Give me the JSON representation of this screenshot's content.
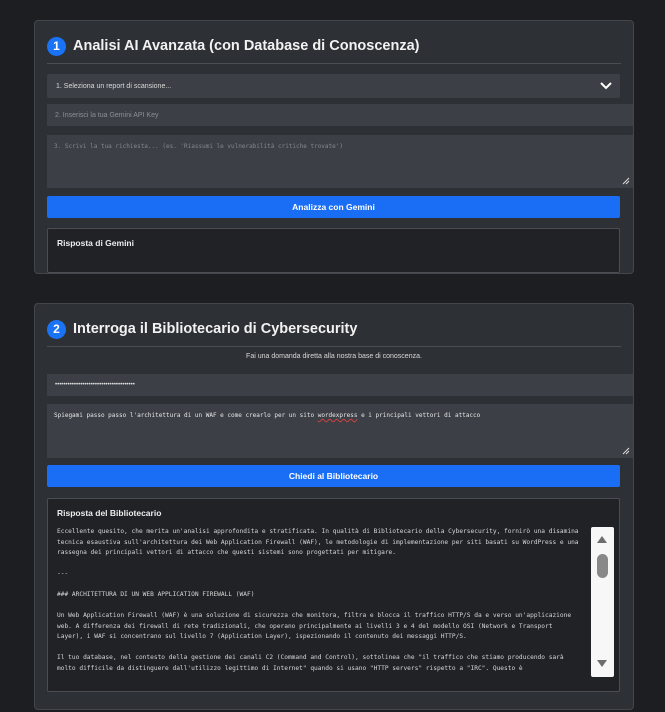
{
  "section1": {
    "number": "1",
    "title": "Analisi AI Avanzata (con Database di Conoscenza)",
    "report_select": "1. Seleziona un report di scansione...",
    "api_key_placeholder": "2. Inserisci la tua Gemini API Key",
    "prompt_placeholder": "3. Scrivi la tua richiesta... (es. 'Riassumi le vulnerabilità critiche trovate')",
    "analyze_button": "Analizza con Gemini",
    "response_title": "Risposta di Gemini"
  },
  "section2": {
    "number": "2",
    "title": "Interroga il Bibliotecario di Cybersecurity",
    "subtitle": "Fai una domanda diretta alla nostra base di conoscenza.",
    "api_key_value": "••••••••••••••••••••••••••••••••••••••",
    "question_part1": "Spiegami passo passo l'architettura di un WAF e come crearlo per un sito ",
    "question_misspelled": "wordexpress",
    "question_part2": " e i principali vettori di attacco",
    "ask_button": "Chiedi al Bibliotecario",
    "response_title": "Risposta del Bibliotecario",
    "response_paragraphs": [
      "Eccellente quesito, che merita un'analisi approfondita e stratificata. In qualità di Bibliotecario della Cybersecurity, fornirò una disamina tecnica esaustiva sull'architettura dei Web Application Firewall (WAF), le metodologie di implementazione per siti basati su WordPress e una rassegna dei principali vettori di attacco che questi sistemi sono progettati per mitigare.",
      "---",
      "### ARCHITETTURA DI UN WEB APPLICATION FIREWALL (WAF)",
      "Un Web Application Firewall (WAF) è una soluzione di sicurezza che monitora, filtra e blocca il traffico HTTP/S da e verso un'applicazione web. A differenza dei firewall di rete tradizionali, che operano principalmente ai livelli 3 e 4 del modello OSI (Network e Transport Layer), i WAF si concentrano sul livello 7 (Application Layer), ispezionando il contenuto dei messaggi HTTP/S.",
      "Il tuo database, nel contesto della gestione dei canali C2 (Command and Control), sottolinea che \"il traffico che stiamo producendo sarà molto difficile da distinguere dall'utilizzo legittimo di Internet\" quando si usano \"HTTP servers\" rispetto a \"IRC\". Questo è"
    ]
  },
  "colors": {
    "page_bg": "#1c1e21",
    "panel_bg": "#2d3035",
    "accent": "#1a6ef5",
    "field_bg": "#3c4046"
  },
  "icons": {
    "select_chevron": "chevron-down-icon",
    "resize": "resize-grip-icon",
    "scroll_up": "arrow-up-icon",
    "scroll_down": "arrow-down-icon"
  }
}
